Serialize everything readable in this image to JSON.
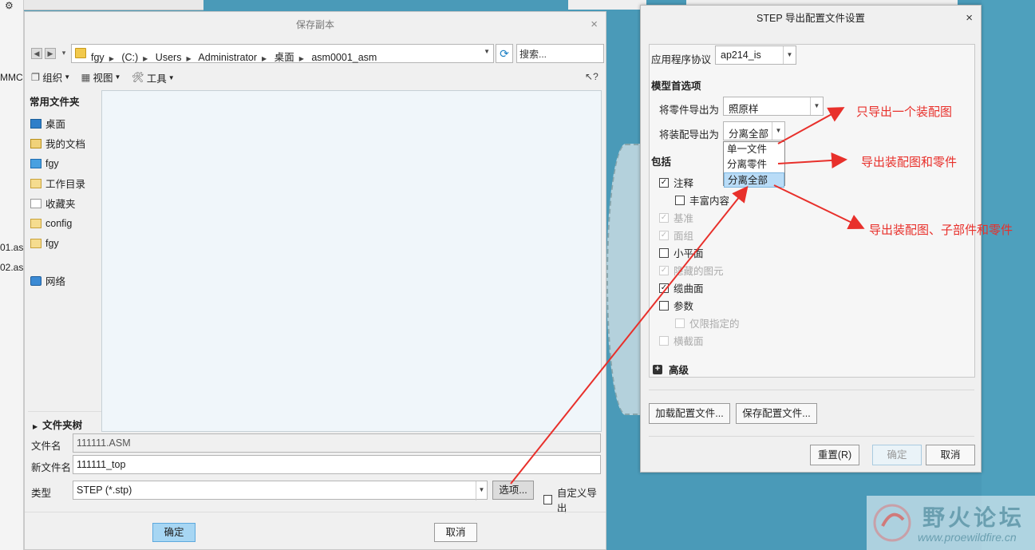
{
  "background": {
    "left_fragments": [
      "MMC",
      "01.as",
      "02.as"
    ]
  },
  "save_dialog": {
    "title": "保存副本",
    "close": "×",
    "breadcrumbs": [
      "fgy",
      "(C:)",
      "Users",
      "Administrator",
      "桌面",
      "asm0001_asm"
    ],
    "search_placeholder": "搜索...",
    "toolbar": {
      "organize": "组织",
      "view": "视图",
      "tools": "工具"
    },
    "help": "?",
    "sidebar": {
      "header": "常用文件夹",
      "items": [
        {
          "label": "桌面",
          "icon": "desktop-icon"
        },
        {
          "label": "我的文档",
          "icon": "documents-icon"
        },
        {
          "label": "fgy",
          "icon": "computer-icon"
        },
        {
          "label": "工作目录",
          "icon": "working-dir-icon"
        },
        {
          "label": "收藏夹",
          "icon": "favorites-icon"
        },
        {
          "label": "config",
          "icon": "folder-icon"
        },
        {
          "label": "fgy",
          "icon": "folder-icon"
        },
        {
          "label": "网络",
          "icon": "network-icon"
        }
      ]
    },
    "folder_tree": "文件夹树",
    "filename_label": "文件名",
    "filename_value": "111111.ASM",
    "newname_label": "新文件名",
    "newname_value": "111111_top",
    "type_label": "类型",
    "type_value": "STEP (*.stp)",
    "options_button": "选项...",
    "custom_export_label": "自定义导出",
    "ok": "确定",
    "cancel": "取消"
  },
  "step_dialog": {
    "title": "STEP 导出配置文件设置",
    "close": "×",
    "protocol_label": "应用程序协议",
    "protocol_value": "ap214_is",
    "model_prefs_label": "模型首选项",
    "part_export_label": "将零件导出为",
    "part_export_value": "照原样",
    "asm_export_label": "将装配导出为",
    "asm_export_value": "分离全部",
    "asm_export_options": [
      "单一文件",
      "分离零件",
      "分离全部"
    ],
    "asm_export_selected_index": 2,
    "include_label": "包括",
    "include_items": [
      {
        "label": "注释",
        "checked": true,
        "disabled": false,
        "indent": 0
      },
      {
        "label": "丰富内容",
        "checked": false,
        "disabled": false,
        "indent": 1
      },
      {
        "label": "基准",
        "checked": true,
        "disabled": true,
        "indent": 0
      },
      {
        "label": "面组",
        "checked": true,
        "disabled": true,
        "indent": 0
      },
      {
        "label": "小平面",
        "checked": false,
        "disabled": false,
        "indent": 0
      },
      {
        "label": "隐藏的图元",
        "checked": true,
        "disabled": true,
        "indent": 0
      },
      {
        "label": "缆曲面",
        "checked": true,
        "disabled": false,
        "indent": 0
      },
      {
        "label": "参数",
        "checked": false,
        "disabled": false,
        "indent": 0
      },
      {
        "label": "仅限指定的",
        "checked": false,
        "disabled": true,
        "indent": 1
      },
      {
        "label": "横截面",
        "checked": false,
        "disabled": true,
        "indent": 0
      }
    ],
    "advanced_label": "高级",
    "load_config": "加载配置文件...",
    "save_config": "保存配置文件...",
    "reset": "重置(R)",
    "ok": "确定",
    "cancel": "取消"
  },
  "annotations": {
    "single_asm": "只导出一个装配图",
    "asm_and_parts": "导出装配图和零件",
    "asm_sub_parts": "导出装配图、子部件和零件",
    "color": "#e8302b"
  },
  "watermark": {
    "title": "野火论坛",
    "url": "www.proewildfire.cn"
  }
}
